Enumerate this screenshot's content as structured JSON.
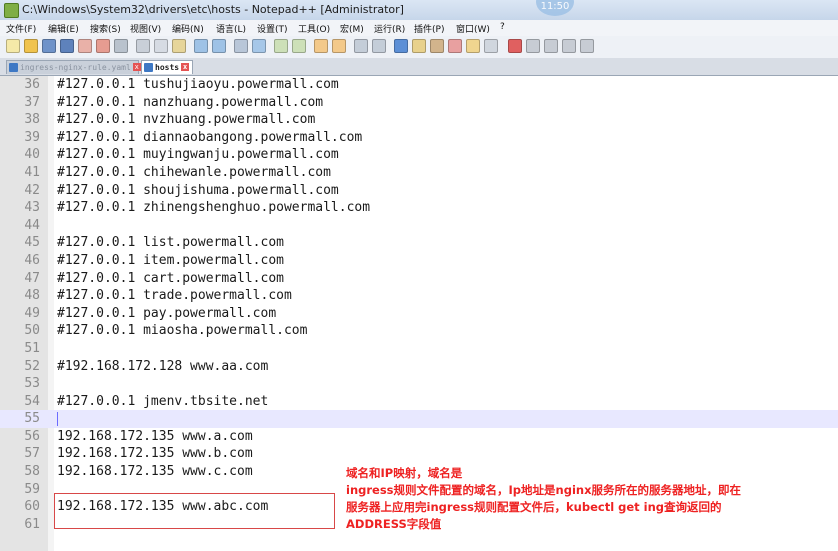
{
  "window": {
    "title": "C:\\Windows\\System32\\drivers\\etc\\hosts - Notepad++ [Administrator]",
    "clock": "11:50"
  },
  "menu": [
    "文件(F)",
    "编辑(E)",
    "搜索(S)",
    "视图(V)",
    "编码(N)",
    "语言(L)",
    "设置(T)",
    "工具(O)",
    "宏(M)",
    "运行(R)",
    "插件(P)",
    "窗口(W)",
    "?"
  ],
  "toolbar": {
    "icons": [
      "new-file-icon",
      "open-file-icon",
      "save-icon",
      "save-all-icon",
      "close-icon",
      "close-all-icon",
      "print-icon",
      "cut-icon",
      "copy-icon",
      "paste-icon",
      "undo-icon",
      "redo-icon",
      "find-icon",
      "replace-icon",
      "zoom-in-icon",
      "zoom-out-icon",
      "sync-v-icon",
      "sync-h-icon",
      "word-wrap-icon",
      "show-all-icon",
      "indent-guide-icon",
      "udl-icon",
      "doc-map-icon",
      "function-list-icon",
      "folder-workspace-icon",
      "monitor-icon",
      "record-macro-icon",
      "stop-macro-icon",
      "play-macro-icon",
      "run-macro-icon",
      "save-macro-icon"
    ]
  },
  "tabs": [
    {
      "label": "ingress-nginx-rule.yaml",
      "close": "x",
      "active": false
    },
    {
      "label": "hosts",
      "close": "x",
      "active": true
    }
  ],
  "lines": [
    {
      "n": "36",
      "text": "#127.0.0.1 tushujiaoyu.powermall.com"
    },
    {
      "n": "37",
      "text": "#127.0.0.1 nanzhuang.powermall.com"
    },
    {
      "n": "38",
      "text": "#127.0.0.1 nvzhuang.powermall.com"
    },
    {
      "n": "39",
      "text": "#127.0.0.1 diannaobangong.powermall.com"
    },
    {
      "n": "40",
      "text": "#127.0.0.1 muyingwanju.powermall.com"
    },
    {
      "n": "41",
      "text": "#127.0.0.1 chihewanle.powermall.com"
    },
    {
      "n": "42",
      "text": "#127.0.0.1 shoujishuma.powermall.com"
    },
    {
      "n": "43",
      "text": "#127.0.0.1 zhinengshenghuo.powermall.com"
    },
    {
      "n": "44",
      "text": ""
    },
    {
      "n": "45",
      "text": "#127.0.0.1 list.powermall.com"
    },
    {
      "n": "46",
      "text": "#127.0.0.1 item.powermall.com"
    },
    {
      "n": "47",
      "text": "#127.0.0.1 cart.powermall.com"
    },
    {
      "n": "48",
      "text": "#127.0.0.1 trade.powermall.com"
    },
    {
      "n": "49",
      "text": "#127.0.0.1 pay.powermall.com"
    },
    {
      "n": "50",
      "text": "#127.0.0.1 miaosha.powermall.com"
    },
    {
      "n": "51",
      "text": ""
    },
    {
      "n": "52",
      "text": "#192.168.172.128 www.aa.com"
    },
    {
      "n": "53",
      "text": ""
    },
    {
      "n": "54",
      "text": "#127.0.0.1 jmenv.tbsite.net"
    },
    {
      "n": "55",
      "text": ""
    },
    {
      "n": "56",
      "text": "192.168.172.135 www.a.com"
    },
    {
      "n": "57",
      "text": "192.168.172.135 www.b.com"
    },
    {
      "n": "58",
      "text": "192.168.172.135 www.c.com"
    },
    {
      "n": "59",
      "text": ""
    },
    {
      "n": "60",
      "text": "192.168.172.135 www.abc.com"
    },
    {
      "n": "61",
      "text": ""
    }
  ],
  "annotation": {
    "color": "#ee2222",
    "lines": [
      "域名和IP映射，域名是",
      "ingress规则文件配置的域名，Ip地址是nginx服务所在的服务器地址，即在",
      "服务器上应用完ingress规则配置文件后，kubectl get ing查询返回的",
      "ADDRESS字段值"
    ]
  }
}
